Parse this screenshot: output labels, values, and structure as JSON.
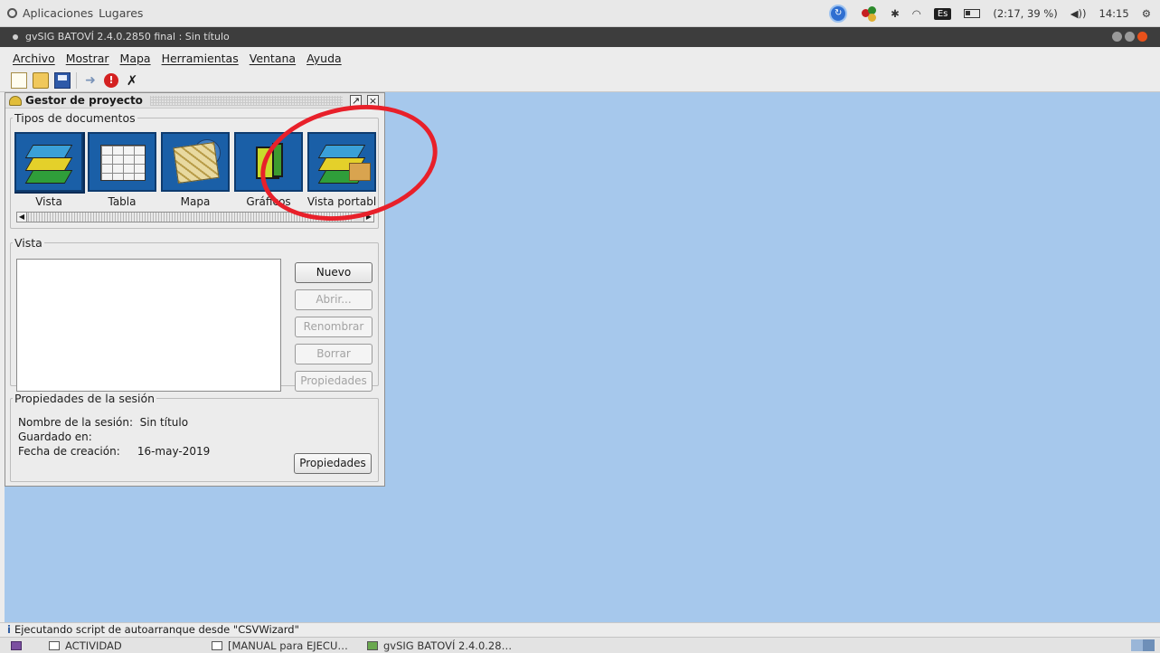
{
  "system_bar": {
    "apps_label": "Aplicaciones",
    "places_label": "Lugares",
    "lang": "Es",
    "battery": "(2:17, 39 %)",
    "clock": "14:15"
  },
  "window": {
    "title": "gvSIG BATOVÍ 2.4.0.2850 final : Sin título"
  },
  "menu": [
    "Archivo",
    "Mostrar",
    "Mapa",
    "Herramientas",
    "Ventana",
    "Ayuda"
  ],
  "project_manager": {
    "title": "Gestor de proyecto",
    "doc_types_legend": "Tipos de documentos",
    "doc_types": [
      {
        "label": "Vista",
        "icon": "view-icon"
      },
      {
        "label": "Tabla",
        "icon": "table-icon"
      },
      {
        "label": "Mapa",
        "icon": "map-icon"
      },
      {
        "label": "Gráficos",
        "icon": "chart-icon"
      },
      {
        "label": "Vista portabl",
        "icon": "portable-view-icon"
      }
    ],
    "vista_legend": "Vista",
    "buttons": {
      "nuevo": "Nuevo",
      "abrir": "Abrir...",
      "renombrar": "Renombrar",
      "borrar": "Borrar",
      "propiedades": "Propiedades"
    },
    "session": {
      "legend": "Propiedades de la sesión",
      "name_label": "Nombre de la sesión:",
      "name_value": "Sin título",
      "saved_label": "Guardado en:",
      "saved_value": "",
      "created_label": "Fecha de creación:",
      "created_value": "16-may-2019",
      "properties_button": "Propiedades"
    }
  },
  "annotation_color": "#e8202a",
  "desktop_color": "#a6c8ec",
  "status_bar": {
    "message": "Ejecutando script de autoarranque desde \"CSVWizard\""
  },
  "taskbar": {
    "items": [
      "ACTIVIDAD",
      "[MANUAL para EJECU…",
      "gvSIG BATOVÍ 2.4.0.28…"
    ]
  }
}
